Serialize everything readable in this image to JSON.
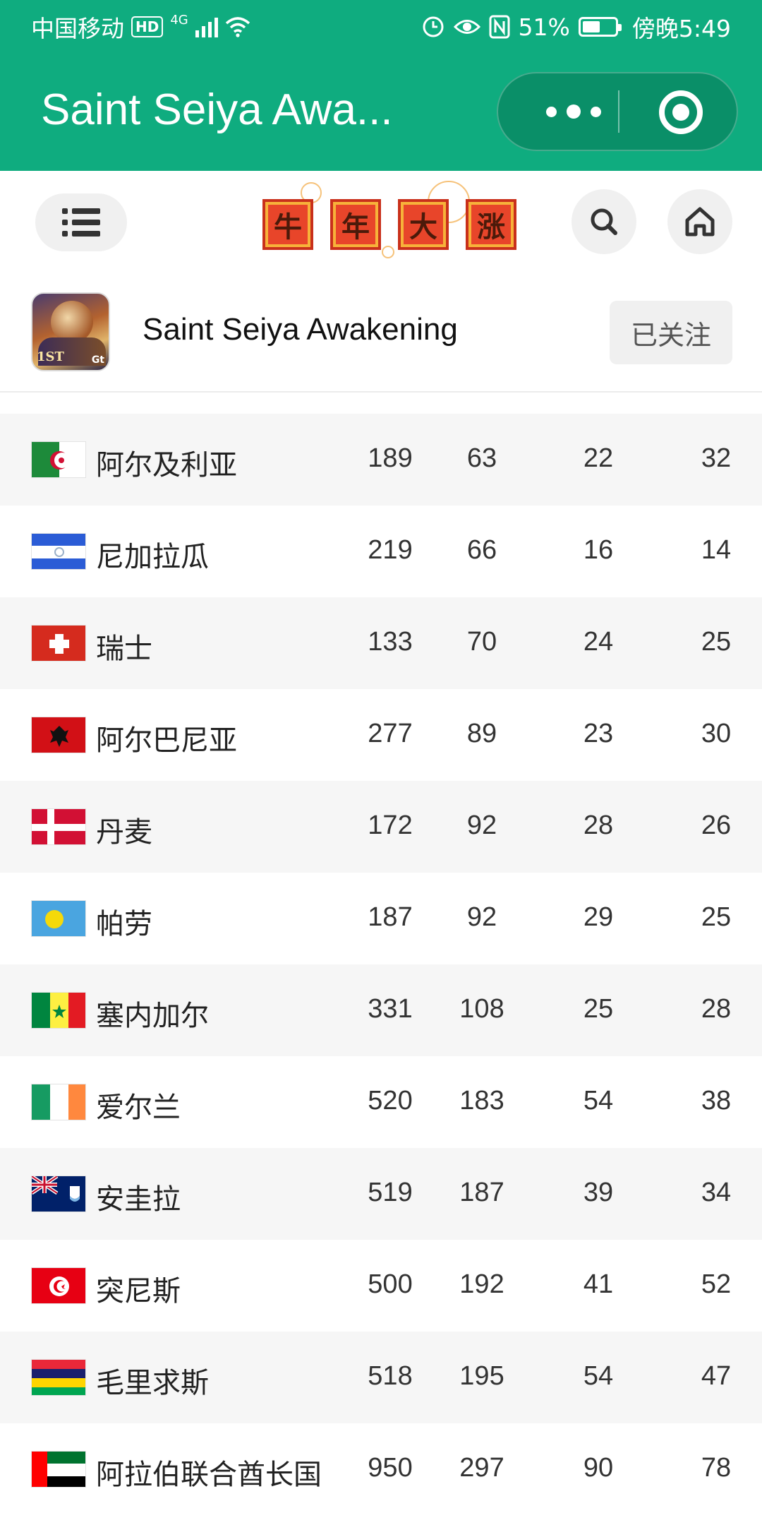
{
  "status_bar": {
    "carrier": "中国移动",
    "hd": "HD",
    "network": "4G",
    "battery": "51%",
    "time": "傍晚5:49"
  },
  "header": {
    "title": "Saint Seiya Awa..."
  },
  "banner": {
    "chars": [
      "牛",
      "年",
      "大",
      "涨"
    ]
  },
  "profile": {
    "app_name": "Saint Seiya Awakening",
    "avatar_label": "1ST",
    "avatar_brand": "Gt",
    "follow_label": "已关注"
  },
  "rows": [
    {
      "country": "阿尔及利亚",
      "v1": "189",
      "v2": "63",
      "v3": "22",
      "v4": "32",
      "flag": "algeria"
    },
    {
      "country": "尼加拉瓜",
      "v1": "219",
      "v2": "66",
      "v3": "16",
      "v4": "14",
      "flag": "nicaragua"
    },
    {
      "country": "瑞士",
      "v1": "133",
      "v2": "70",
      "v3": "24",
      "v4": "25",
      "flag": "switzerland"
    },
    {
      "country": "阿尔巴尼亚",
      "v1": "277",
      "v2": "89",
      "v3": "23",
      "v4": "30",
      "flag": "albania"
    },
    {
      "country": "丹麦",
      "v1": "172",
      "v2": "92",
      "v3": "28",
      "v4": "26",
      "flag": "denmark"
    },
    {
      "country": "帕劳",
      "v1": "187",
      "v2": "92",
      "v3": "29",
      "v4": "25",
      "flag": "palau"
    },
    {
      "country": "塞内加尔",
      "v1": "331",
      "v2": "108",
      "v3": "25",
      "v4": "28",
      "flag": "senegal"
    },
    {
      "country": "爱尔兰",
      "v1": "520",
      "v2": "183",
      "v3": "54",
      "v4": "38",
      "flag": "ireland"
    },
    {
      "country": "安圭拉",
      "v1": "519",
      "v2": "187",
      "v3": "39",
      "v4": "34",
      "flag": "anguilla"
    },
    {
      "country": "突尼斯",
      "v1": "500",
      "v2": "192",
      "v3": "41",
      "v4": "52",
      "flag": "tunisia"
    },
    {
      "country": "毛里求斯",
      "v1": "518",
      "v2": "195",
      "v3": "54",
      "v4": "47",
      "flag": "mauritius"
    },
    {
      "country": "阿拉伯联合酋长国",
      "v1": "950",
      "v2": "297",
      "v3": "90",
      "v4": "78",
      "flag": "uae"
    }
  ],
  "colors": {
    "brand_green": "#0fac7f",
    "row_shade": "#f6f6f6"
  }
}
